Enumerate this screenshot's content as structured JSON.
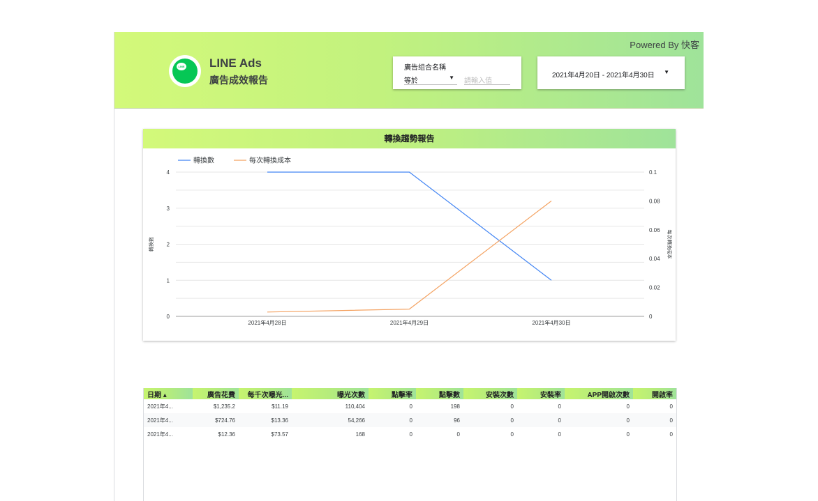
{
  "header": {
    "powered_by": "Powered By 快客",
    "brand_title": "LINE Ads",
    "brand_subtitle": "廣告成效報告",
    "logo_text": "LINE"
  },
  "filter": {
    "label": "廣告组合名稱",
    "operator": "等於",
    "placeholder": "請輸入值"
  },
  "date_range": {
    "text": "2021年4月20日 - 2021年4月30日"
  },
  "colors": {
    "header_start": "#d3f97a",
    "header_end": "#9fe39a",
    "series_1": "#4285f4",
    "series_2": "#f4a261"
  },
  "chart_data": {
    "type": "line",
    "title": "轉換趨勢報告",
    "categories": [
      "2021年4月28日",
      "2021年4月29日",
      "2021年4月30日"
    ],
    "series": [
      {
        "name": "轉換數",
        "axis": "left",
        "color": "#4285f4",
        "values": [
          4,
          4,
          1
        ]
      },
      {
        "name": "每次轉換成本",
        "axis": "right",
        "color": "#f4a261",
        "values": [
          0.003,
          0.005,
          0.08
        ]
      }
    ],
    "ylabel": "轉換數",
    "y2label": "每次轉換成本",
    "ylim": [
      0,
      4
    ],
    "y2lim": [
      0,
      0.1
    ],
    "yticks": [
      "0",
      "1",
      "2",
      "3",
      "4"
    ],
    "y2ticks": [
      "0",
      "0.02",
      "0.04",
      "0.06",
      "0.08",
      "0.1"
    ],
    "grid": true,
    "legend": "top-left"
  },
  "table": {
    "columns": [
      "日期 ▴",
      "廣告花費",
      "每千次曝光...",
      "曝光次數",
      "點擊率",
      "點擊數",
      "安裝次數",
      "安裝率",
      "APP開啟次數",
      "開啟率"
    ],
    "rows": [
      [
        "2021年4...",
        "$1,235.2",
        "$11.19",
        "110,404",
        "0",
        "198",
        "0",
        "0",
        "0",
        "0"
      ],
      [
        "2021年4...",
        "$724.76",
        "$13.36",
        "54,266",
        "0",
        "96",
        "0",
        "0",
        "0",
        "0"
      ],
      [
        "2021年4...",
        "$12.36",
        "$73.57",
        "168",
        "0",
        "0",
        "0",
        "0",
        "0",
        "0"
      ]
    ]
  }
}
